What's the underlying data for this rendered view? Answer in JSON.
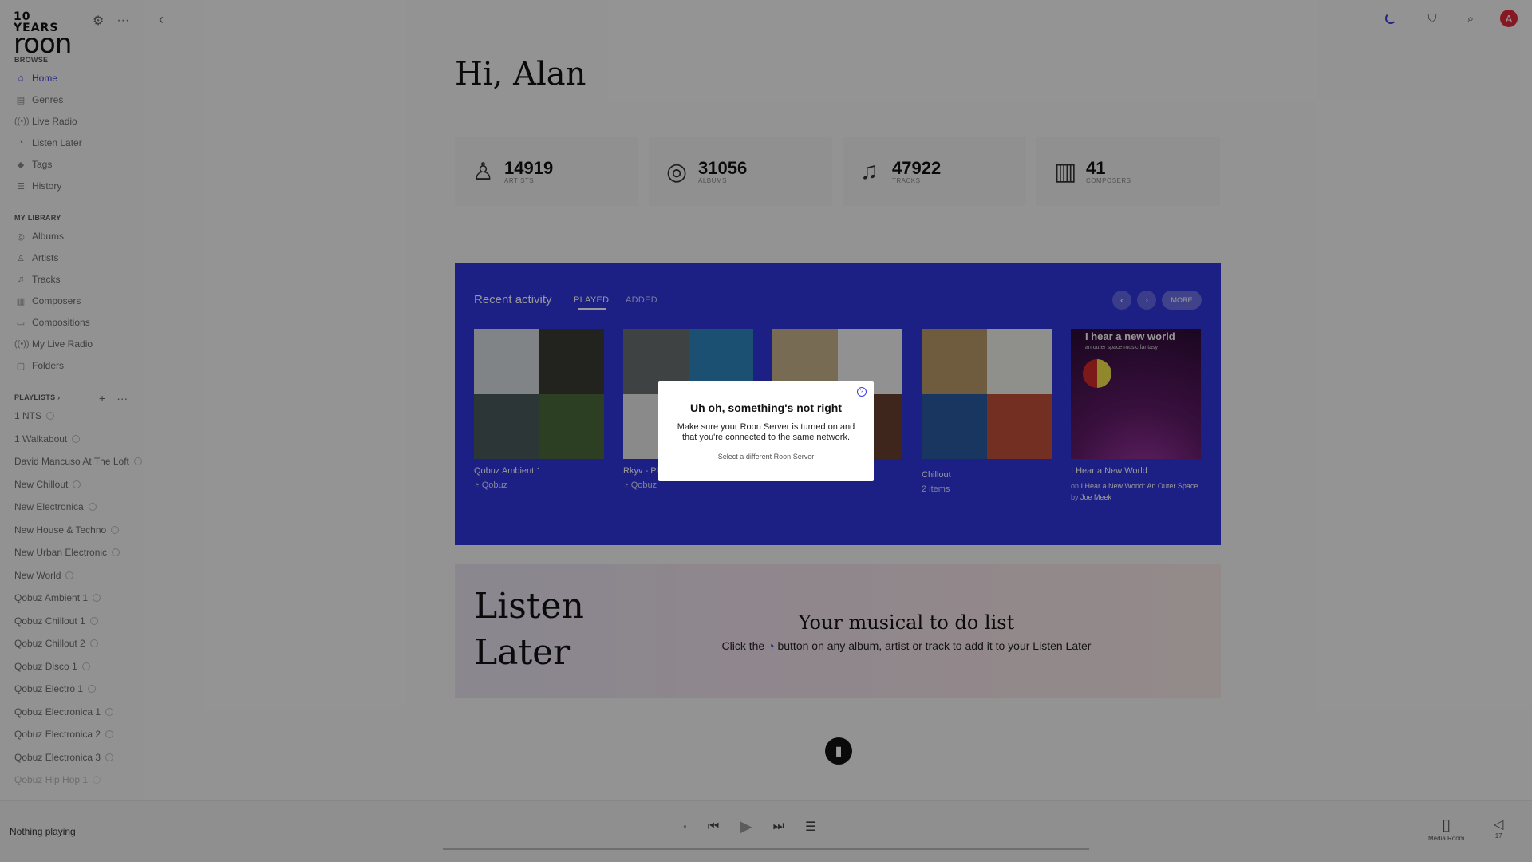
{
  "logo": {
    "top_line": "10 YEARS",
    "wordmark": "roon"
  },
  "sidebar": {
    "browse_title": "BROWSE",
    "browse": [
      {
        "label": "Home",
        "icon": "home-icon",
        "glyph": "⌂"
      },
      {
        "label": "Genres",
        "icon": "genres-icon",
        "glyph": "▤"
      },
      {
        "label": "Live Radio",
        "icon": "radio-icon",
        "glyph": "((•))"
      },
      {
        "label": "Listen Later",
        "icon": "listen-later-icon",
        "glyph": "◔"
      },
      {
        "label": "Tags",
        "icon": "tag-icon",
        "glyph": "◆"
      },
      {
        "label": "History",
        "icon": "history-icon",
        "glyph": "☰"
      }
    ],
    "library_title": "MY LIBRARY",
    "library": [
      {
        "label": "Albums",
        "icon": "album-icon",
        "glyph": "◎"
      },
      {
        "label": "Artists",
        "icon": "artist-icon",
        "glyph": "♙"
      },
      {
        "label": "Tracks",
        "icon": "track-icon",
        "glyph": "♫"
      },
      {
        "label": "Composers",
        "icon": "composer-icon",
        "glyph": "▥"
      },
      {
        "label": "Compositions",
        "icon": "composition-icon",
        "glyph": "▭"
      },
      {
        "label": "My Live Radio",
        "icon": "radio-icon",
        "glyph": "((•))"
      },
      {
        "label": "Folders",
        "icon": "folder-icon",
        "glyph": "▢"
      }
    ],
    "playlists_title": "PLAYLISTS ›",
    "playlists": [
      "1 NTS",
      "1 Walkabout",
      "David Mancuso At The Loft",
      "New Chillout",
      "New Electronica",
      "New House & Techno",
      "New Urban Electronic",
      "New World",
      "Qobuz Ambient 1",
      "Qobuz Chillout 1",
      "Qobuz Chillout 2",
      "Qobuz Disco 1",
      "Qobuz Electro 1",
      "Qobuz Electronica 1",
      "Qobuz Electronica 2",
      "Qobuz Electronica 3",
      "Qobuz Hip Hop 1"
    ]
  },
  "main": {
    "greeting": "Hi, Alan",
    "stats": [
      {
        "value": "14919",
        "label": "ARTISTS",
        "icon": "artist-icon",
        "glyph": "♙"
      },
      {
        "value": "31056",
        "label": "ALBUMS",
        "icon": "album-icon",
        "glyph": "◎"
      },
      {
        "value": "47922",
        "label": "TRACKS",
        "icon": "track-icon",
        "glyph": "♫"
      },
      {
        "value": "41",
        "label": "COMPOSERS",
        "icon": "composer-icon",
        "glyph": "▥"
      }
    ],
    "recent": {
      "title": "Recent activity",
      "tab_played": "PLAYED",
      "tab_added": "ADDED",
      "more": "MORE",
      "cards": [
        {
          "title": "Qobuz Ambient 1",
          "sub": "Qobuz",
          "colors": [
            "#d8dde2",
            "#3a3a32",
            "#4a5a5a",
            "#4c6a3a"
          ]
        },
        {
          "title": "Rkyv - Pl",
          "sub": "Qobuz",
          "colors": [
            "#6a6f70",
            "#2e86c0",
            "#e6e6e6",
            "#c84a2a"
          ]
        },
        {
          "title": "",
          "sub": "Qobuz",
          "colors": [
            "#c9b28a",
            "#f2f2f2",
            "#8a5a3a",
            "#6a4030"
          ]
        },
        {
          "title": "Chillout",
          "sub": "2 items",
          "colors": [
            "#b99a6a",
            "#eeeeea",
            "#2a5aa0",
            "#c0503a"
          ]
        },
        {
          "title": "I Hear a New World",
          "sub_prefix": "on ",
          "sub_album": "I Hear a New World: An Outer Space",
          "sub_by": "by ",
          "sub_artist": "Joe Meek",
          "art_title": "I hear a new world",
          "art_sub": "an outer space music fantasy",
          "colors": [
            "#6a1a6e",
            "#6a1a6e",
            "#6a1a6e",
            "#6a1a6e"
          ]
        }
      ]
    },
    "listen_later": {
      "big_line1": "Listen",
      "big_line2": "Later",
      "heading": "Your musical to do list",
      "hint_pre": "Click the ",
      "hint_post": " button on any album, artist or track to add it to your Listen Later"
    }
  },
  "player": {
    "now_playing": "Nothing playing",
    "zone": "Media Room",
    "volume": "17"
  },
  "dialog": {
    "title": "Uh oh, something's not right",
    "message": "Make sure your Roon Server is turned on and that you're connected to the same network.",
    "link": "Select a different Roon Server",
    "help": "?"
  }
}
